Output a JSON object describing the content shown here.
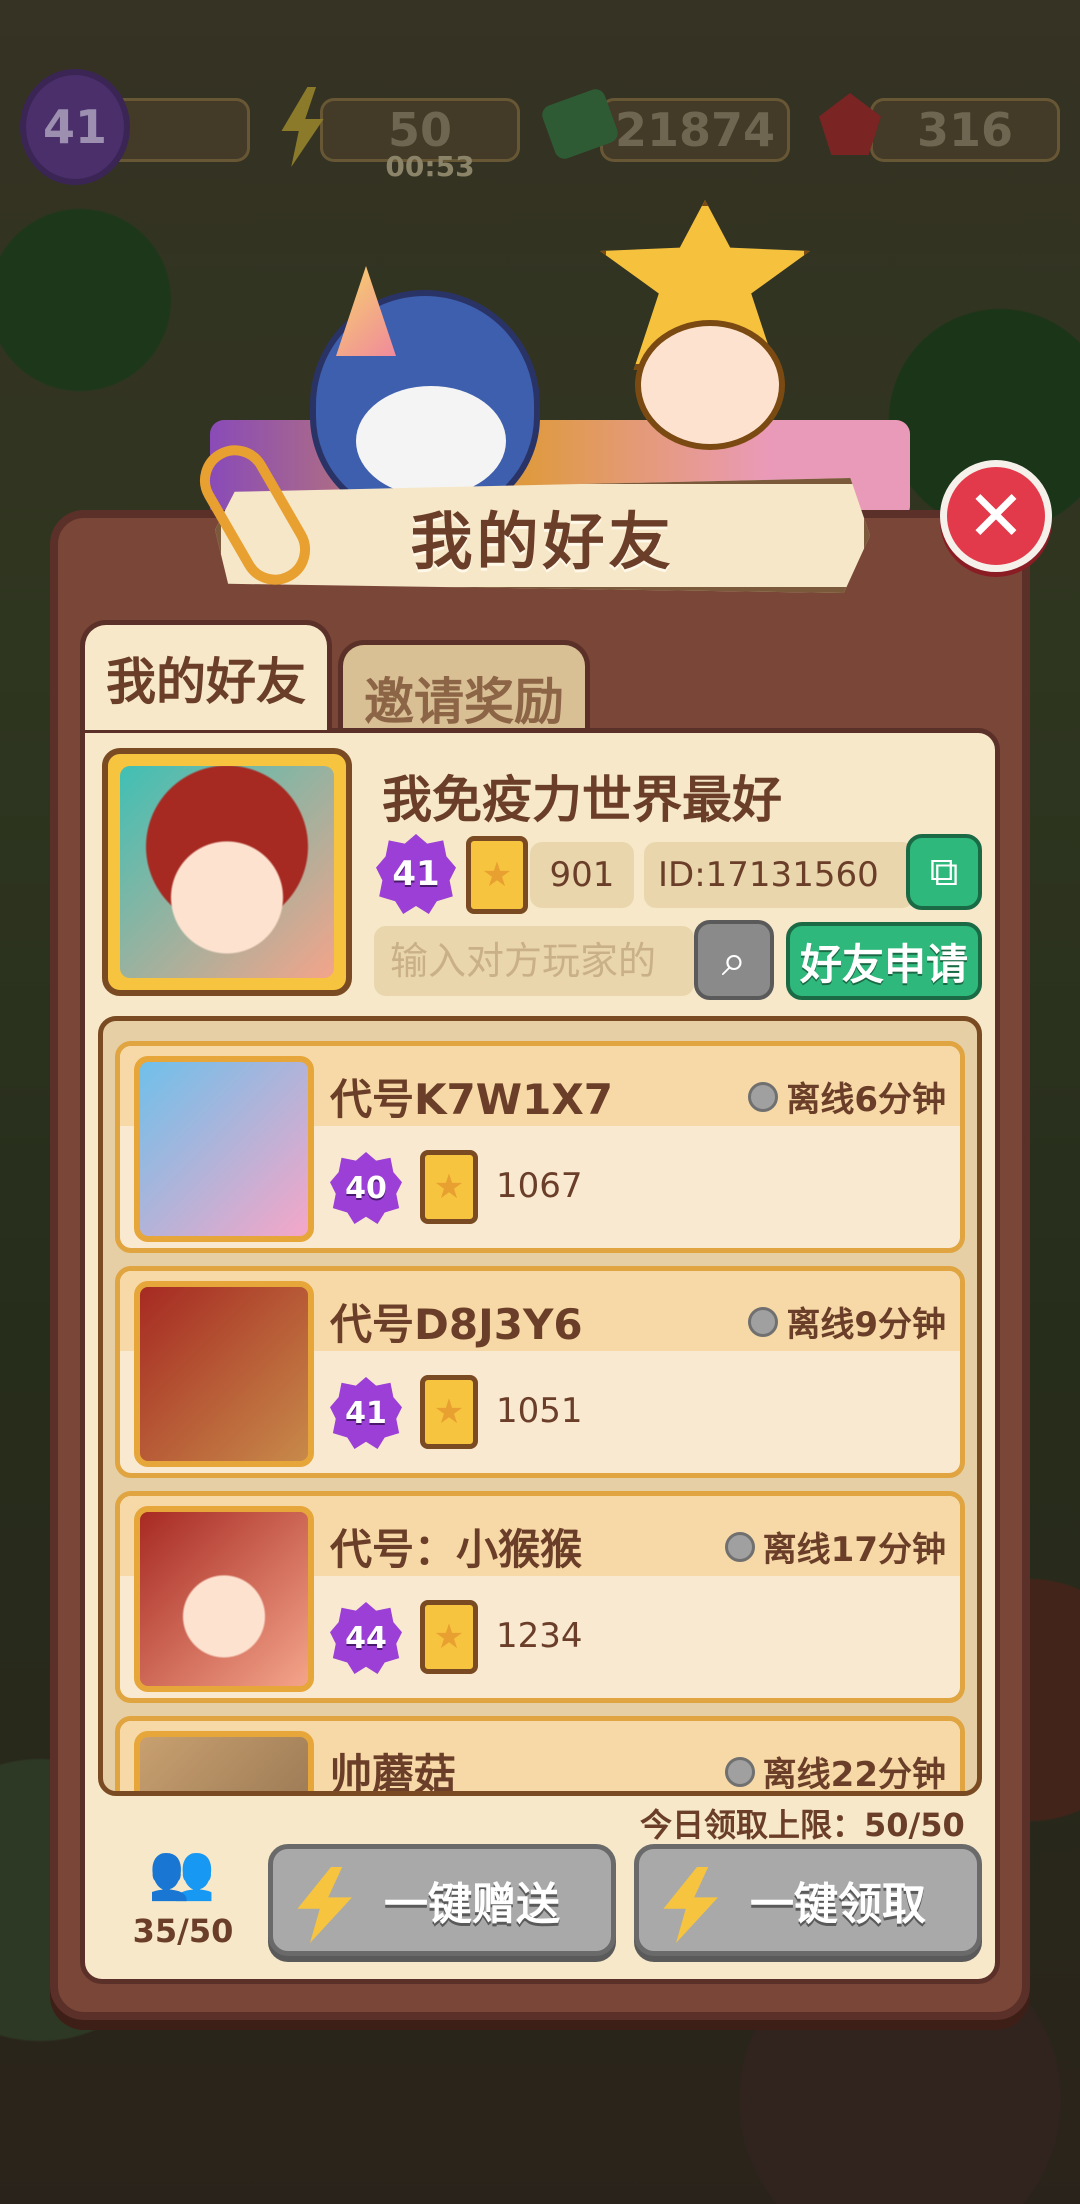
{
  "top_bar": {
    "level": "41",
    "energy": "50",
    "energy_timer": "00:53",
    "cash": "21874",
    "gems": "316"
  },
  "dialog": {
    "title": "我的好友",
    "close_icon": "close-icon"
  },
  "tabs": [
    {
      "label": "我的好友",
      "active": true
    },
    {
      "label": "邀请奖励",
      "active": false
    }
  ],
  "me": {
    "name": "我免疫力世界最好",
    "level": "41",
    "points": "901",
    "id": "ID:17131560",
    "search_placeholder": "输入对方玩家的",
    "friend_request_label": "好友申请"
  },
  "friends": [
    {
      "name": "代号K7W1X7",
      "status": "离线6分钟",
      "level": "40",
      "points": "1067"
    },
    {
      "name": "代号D8J3Y6",
      "status": "离线9分钟",
      "level": "41",
      "points": "1051"
    },
    {
      "name": "代号：小猴猴",
      "status": "离线17分钟",
      "level": "44",
      "points": "1234"
    },
    {
      "name": "帅蘑菇",
      "status": "离线22分钟",
      "level": "",
      "points": ""
    }
  ],
  "footer": {
    "daily_limit": "今日领取上限：50/50",
    "friend_count": "35/50",
    "send_all_label": "一键赠送",
    "claim_all_label": "一键领取"
  },
  "colors": {
    "panel": "#7a4638",
    "content_bg": "#f6e8c8",
    "accent_green": "#2fb87c",
    "close_red": "#e23a4a",
    "level_purple": "#9b3fd6"
  }
}
